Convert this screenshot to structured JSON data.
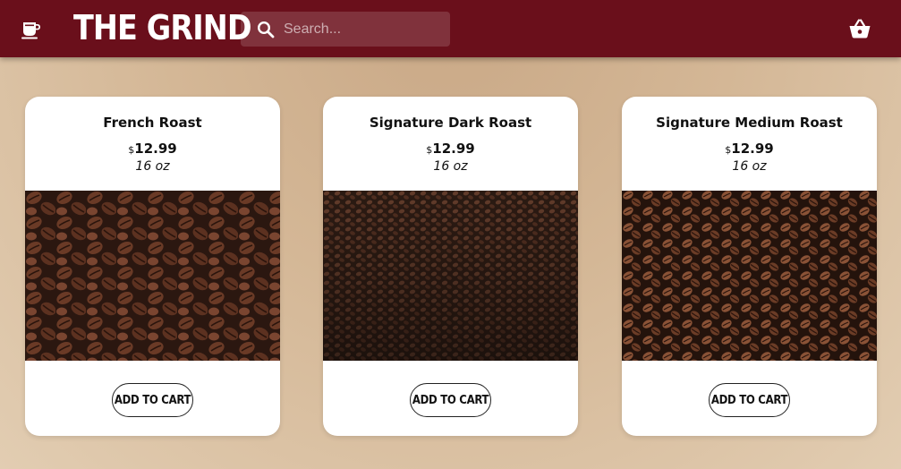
{
  "nav": {
    "logo_icon": "coffee-cup-icon",
    "brand": "THE GRIND",
    "search_placeholder": "Search...",
    "search_icon": "search-icon",
    "cart_icon": "shopping-basket-icon",
    "background_color": "#6a0f1b"
  },
  "products": [
    {
      "name": "French Roast",
      "currency": "$",
      "price": "12.99",
      "size": "16 oz",
      "button_label": "ADD TO CART"
    },
    {
      "name": "Signature Dark Roast",
      "currency": "$",
      "price": "12.99",
      "size": "16 oz",
      "button_label": "ADD TO CART"
    },
    {
      "name": "Signature Medium Roast",
      "currency": "$",
      "price": "12.99",
      "size": "16 oz",
      "button_label": "ADD TO CART"
    }
  ]
}
